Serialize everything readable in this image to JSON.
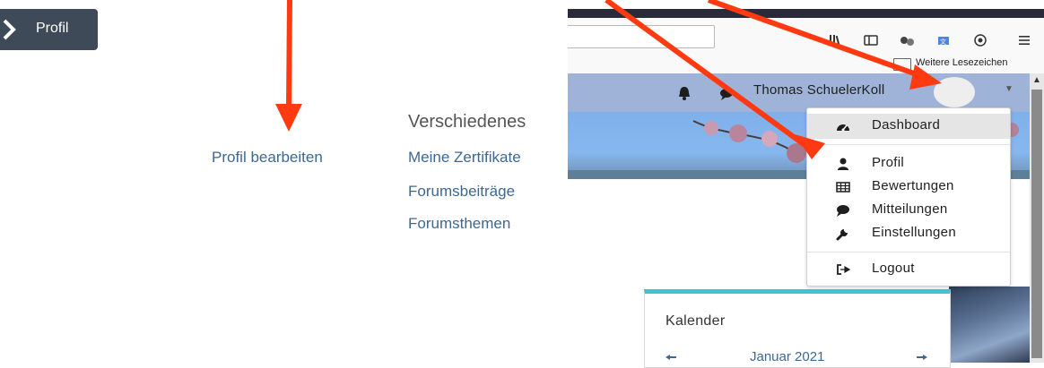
{
  "breadcrumb": {
    "label": "Profil"
  },
  "profile_links": {
    "edit": "Profil bearbeiten"
  },
  "misc": {
    "heading": "Verschiedenes",
    "items": [
      "Meine Zertifikate",
      "Forumsbeiträge",
      "Forumsthemen"
    ]
  },
  "browser": {
    "bookmarks_label": "Weitere Lesezeichen",
    "toolbar_icons": [
      "library-icon",
      "sidebar-icon",
      "extension-icon",
      "translate-icon",
      "privacy-icon",
      "menu-icon"
    ]
  },
  "header": {
    "user_name": "Thomas SchuelerKoll"
  },
  "user_menu": {
    "items": [
      {
        "label": "Dashboard",
        "icon": "dashboard-icon",
        "active": true
      },
      {
        "label": "Profil",
        "icon": "user-icon"
      },
      {
        "label": "Bewertungen",
        "icon": "table-icon"
      },
      {
        "label": "Mitteilungen",
        "icon": "comment-icon"
      },
      {
        "label": "Einstellungen",
        "icon": "wrench-icon"
      },
      {
        "label": "Logout",
        "icon": "sign-out-icon"
      }
    ]
  },
  "calendar": {
    "title": "Kalender",
    "month": "Januar 2021"
  },
  "colors": {
    "accent_arrow": "#ff3a10",
    "link": "#3e6891",
    "calendar_accent": "#3fc4cc",
    "appbar": "#9fb3d9"
  }
}
